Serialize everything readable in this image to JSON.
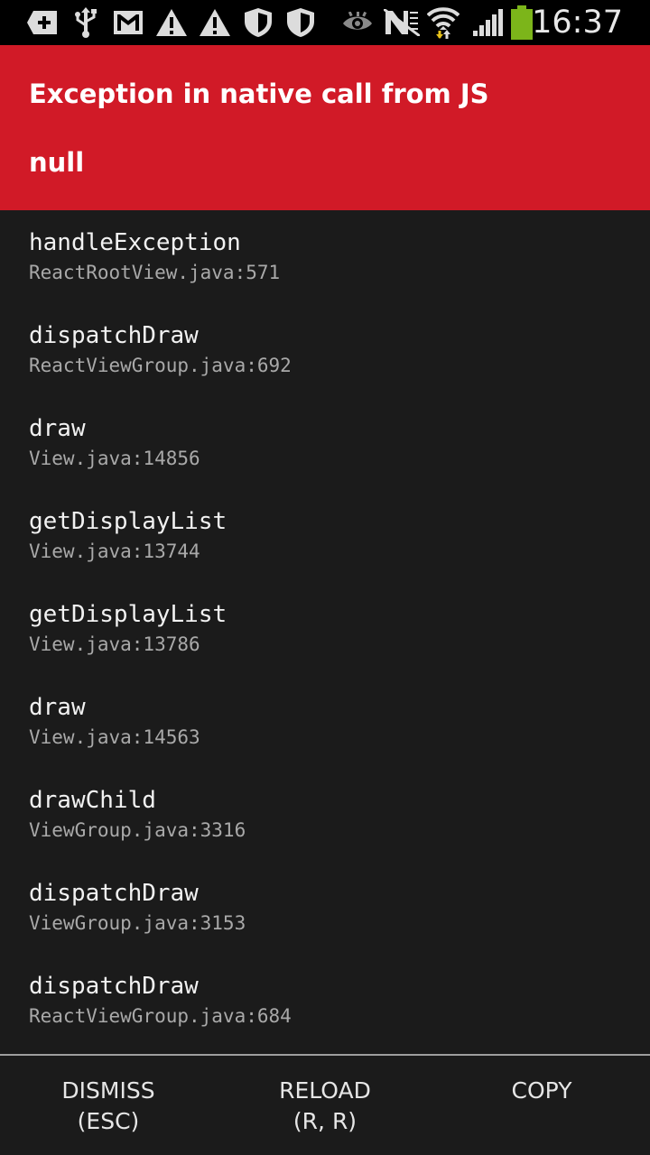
{
  "status_bar": {
    "time": "16:37",
    "icons": [
      "add-box-icon",
      "usb-icon",
      "gmail-icon",
      "warning-icon",
      "warning-icon",
      "shield-icon",
      "shield-icon",
      "eye-icon",
      "nfc-icon",
      "wifi-icon",
      "signal-icon",
      "battery-icon"
    ],
    "battery_color": "#7cb51a"
  },
  "error": {
    "title": "Exception in native call from JS",
    "message": "null",
    "header_color": "#d11a27"
  },
  "stack": [
    {
      "method": "handleException",
      "location": "ReactRootView.java:571"
    },
    {
      "method": "dispatchDraw",
      "location": "ReactViewGroup.java:692"
    },
    {
      "method": "draw",
      "location": "View.java:14856"
    },
    {
      "method": "getDisplayList",
      "location": "View.java:13744"
    },
    {
      "method": "getDisplayList",
      "location": "View.java:13786"
    },
    {
      "method": "draw",
      "location": "View.java:14563"
    },
    {
      "method": "drawChild",
      "location": "ViewGroup.java:3316"
    },
    {
      "method": "dispatchDraw",
      "location": "ViewGroup.java:3153"
    },
    {
      "method": "dispatchDraw",
      "location": "ReactViewGroup.java:684"
    }
  ],
  "buttons": {
    "dismiss": {
      "label": "DISMISS",
      "shortcut": "(ESC)"
    },
    "reload": {
      "label": "RELOAD",
      "shortcut": "(R, R)"
    },
    "copy": {
      "label": "COPY"
    }
  }
}
